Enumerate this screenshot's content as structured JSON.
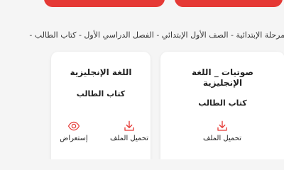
{
  "header": {
    "buttons": [
      {
        "label": ""
      },
      {
        "label": ""
      }
    ]
  },
  "breadcrumb": "المرحلة الإبتدائية - الصف الأول الإبتدائي - الفصل الدراسي الأول - كتاب الطالب -",
  "cards": [
    {
      "title": "صوتيات _ اللغة الإنجليزية",
      "subtitle": "كتاب الطالب",
      "actions": [
        {
          "label": "تحميل الملف",
          "icon": "download-icon"
        }
      ]
    },
    {
      "title": "اللغة الإنجليزية",
      "subtitle": "كتاب الطالب",
      "actions": [
        {
          "label": "تحميل الملف",
          "icon": "download-icon"
        },
        {
          "label": "إستعراض",
          "icon": "eye-icon"
        }
      ]
    }
  ],
  "colors": {
    "accent": "#e53935",
    "background": "#f5f5f5",
    "card": "#ffffff"
  }
}
